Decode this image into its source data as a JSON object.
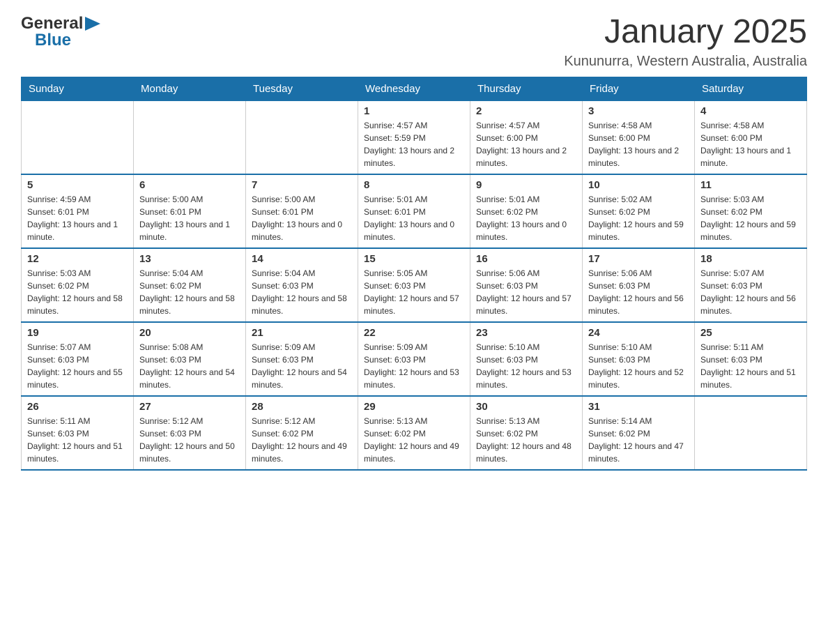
{
  "header": {
    "logo": {
      "text_general": "General",
      "text_blue": "Blue",
      "alt": "GeneralBlue logo"
    },
    "title": "January 2025",
    "subtitle": "Kununurra, Western Australia, Australia"
  },
  "calendar": {
    "days_of_week": [
      "Sunday",
      "Monday",
      "Tuesday",
      "Wednesday",
      "Thursday",
      "Friday",
      "Saturday"
    ],
    "weeks": [
      [
        {
          "day": "",
          "sunrise": "",
          "sunset": "",
          "daylight": ""
        },
        {
          "day": "",
          "sunrise": "",
          "sunset": "",
          "daylight": ""
        },
        {
          "day": "",
          "sunrise": "",
          "sunset": "",
          "daylight": ""
        },
        {
          "day": "1",
          "sunrise": "Sunrise: 4:57 AM",
          "sunset": "Sunset: 5:59 PM",
          "daylight": "Daylight: 13 hours and 2 minutes."
        },
        {
          "day": "2",
          "sunrise": "Sunrise: 4:57 AM",
          "sunset": "Sunset: 6:00 PM",
          "daylight": "Daylight: 13 hours and 2 minutes."
        },
        {
          "day": "3",
          "sunrise": "Sunrise: 4:58 AM",
          "sunset": "Sunset: 6:00 PM",
          "daylight": "Daylight: 13 hours and 2 minutes."
        },
        {
          "day": "4",
          "sunrise": "Sunrise: 4:58 AM",
          "sunset": "Sunset: 6:00 PM",
          "daylight": "Daylight: 13 hours and 1 minute."
        }
      ],
      [
        {
          "day": "5",
          "sunrise": "Sunrise: 4:59 AM",
          "sunset": "Sunset: 6:01 PM",
          "daylight": "Daylight: 13 hours and 1 minute."
        },
        {
          "day": "6",
          "sunrise": "Sunrise: 5:00 AM",
          "sunset": "Sunset: 6:01 PM",
          "daylight": "Daylight: 13 hours and 1 minute."
        },
        {
          "day": "7",
          "sunrise": "Sunrise: 5:00 AM",
          "sunset": "Sunset: 6:01 PM",
          "daylight": "Daylight: 13 hours and 0 minutes."
        },
        {
          "day": "8",
          "sunrise": "Sunrise: 5:01 AM",
          "sunset": "Sunset: 6:01 PM",
          "daylight": "Daylight: 13 hours and 0 minutes."
        },
        {
          "day": "9",
          "sunrise": "Sunrise: 5:01 AM",
          "sunset": "Sunset: 6:02 PM",
          "daylight": "Daylight: 13 hours and 0 minutes."
        },
        {
          "day": "10",
          "sunrise": "Sunrise: 5:02 AM",
          "sunset": "Sunset: 6:02 PM",
          "daylight": "Daylight: 12 hours and 59 minutes."
        },
        {
          "day": "11",
          "sunrise": "Sunrise: 5:03 AM",
          "sunset": "Sunset: 6:02 PM",
          "daylight": "Daylight: 12 hours and 59 minutes."
        }
      ],
      [
        {
          "day": "12",
          "sunrise": "Sunrise: 5:03 AM",
          "sunset": "Sunset: 6:02 PM",
          "daylight": "Daylight: 12 hours and 58 minutes."
        },
        {
          "day": "13",
          "sunrise": "Sunrise: 5:04 AM",
          "sunset": "Sunset: 6:02 PM",
          "daylight": "Daylight: 12 hours and 58 minutes."
        },
        {
          "day": "14",
          "sunrise": "Sunrise: 5:04 AM",
          "sunset": "Sunset: 6:03 PM",
          "daylight": "Daylight: 12 hours and 58 minutes."
        },
        {
          "day": "15",
          "sunrise": "Sunrise: 5:05 AM",
          "sunset": "Sunset: 6:03 PM",
          "daylight": "Daylight: 12 hours and 57 minutes."
        },
        {
          "day": "16",
          "sunrise": "Sunrise: 5:06 AM",
          "sunset": "Sunset: 6:03 PM",
          "daylight": "Daylight: 12 hours and 57 minutes."
        },
        {
          "day": "17",
          "sunrise": "Sunrise: 5:06 AM",
          "sunset": "Sunset: 6:03 PM",
          "daylight": "Daylight: 12 hours and 56 minutes."
        },
        {
          "day": "18",
          "sunrise": "Sunrise: 5:07 AM",
          "sunset": "Sunset: 6:03 PM",
          "daylight": "Daylight: 12 hours and 56 minutes."
        }
      ],
      [
        {
          "day": "19",
          "sunrise": "Sunrise: 5:07 AM",
          "sunset": "Sunset: 6:03 PM",
          "daylight": "Daylight: 12 hours and 55 minutes."
        },
        {
          "day": "20",
          "sunrise": "Sunrise: 5:08 AM",
          "sunset": "Sunset: 6:03 PM",
          "daylight": "Daylight: 12 hours and 54 minutes."
        },
        {
          "day": "21",
          "sunrise": "Sunrise: 5:09 AM",
          "sunset": "Sunset: 6:03 PM",
          "daylight": "Daylight: 12 hours and 54 minutes."
        },
        {
          "day": "22",
          "sunrise": "Sunrise: 5:09 AM",
          "sunset": "Sunset: 6:03 PM",
          "daylight": "Daylight: 12 hours and 53 minutes."
        },
        {
          "day": "23",
          "sunrise": "Sunrise: 5:10 AM",
          "sunset": "Sunset: 6:03 PM",
          "daylight": "Daylight: 12 hours and 53 minutes."
        },
        {
          "day": "24",
          "sunrise": "Sunrise: 5:10 AM",
          "sunset": "Sunset: 6:03 PM",
          "daylight": "Daylight: 12 hours and 52 minutes."
        },
        {
          "day": "25",
          "sunrise": "Sunrise: 5:11 AM",
          "sunset": "Sunset: 6:03 PM",
          "daylight": "Daylight: 12 hours and 51 minutes."
        }
      ],
      [
        {
          "day": "26",
          "sunrise": "Sunrise: 5:11 AM",
          "sunset": "Sunset: 6:03 PM",
          "daylight": "Daylight: 12 hours and 51 minutes."
        },
        {
          "day": "27",
          "sunrise": "Sunrise: 5:12 AM",
          "sunset": "Sunset: 6:03 PM",
          "daylight": "Daylight: 12 hours and 50 minutes."
        },
        {
          "day": "28",
          "sunrise": "Sunrise: 5:12 AM",
          "sunset": "Sunset: 6:02 PM",
          "daylight": "Daylight: 12 hours and 49 minutes."
        },
        {
          "day": "29",
          "sunrise": "Sunrise: 5:13 AM",
          "sunset": "Sunset: 6:02 PM",
          "daylight": "Daylight: 12 hours and 49 minutes."
        },
        {
          "day": "30",
          "sunrise": "Sunrise: 5:13 AM",
          "sunset": "Sunset: 6:02 PM",
          "daylight": "Daylight: 12 hours and 48 minutes."
        },
        {
          "day": "31",
          "sunrise": "Sunrise: 5:14 AM",
          "sunset": "Sunset: 6:02 PM",
          "daylight": "Daylight: 12 hours and 47 minutes."
        },
        {
          "day": "",
          "sunrise": "",
          "sunset": "",
          "daylight": ""
        }
      ]
    ]
  }
}
